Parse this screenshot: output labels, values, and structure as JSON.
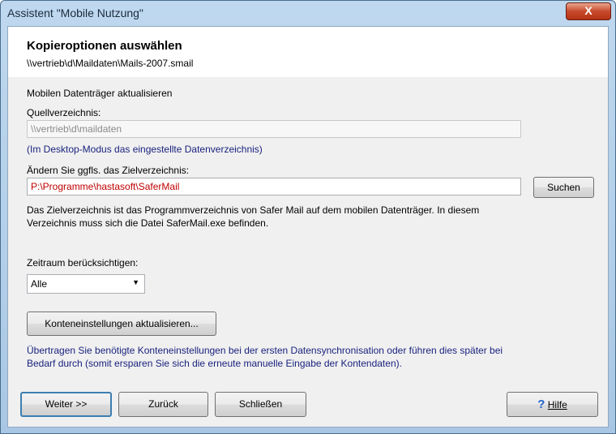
{
  "window": {
    "title": "Assistent \"Mobile Nutzung\"",
    "close_label": "X"
  },
  "header": {
    "title": "Kopieroptionen auswählen",
    "path": "\\\\vertrieb\\d\\Maildaten\\Mails-2007.smail"
  },
  "section": {
    "heading": "Mobilen Datenträger aktualisieren",
    "source_label": "Quellverzeichnis:",
    "source_value": "\\\\vertrieb\\d\\maildaten",
    "source_hint": "(Im Desktop-Modus das eingestellte Datenverzeichnis)",
    "target_label": "Ändern Sie ggfls. das Zielverzeichnis:",
    "target_value": "P:\\Programme\\hastasoft\\SaferMail",
    "search_button": "Suchen",
    "target_info": "Das Zielverzeichnis ist das Programmverzeichnis von Safer Mail auf dem mobilen Datenträger. In diesem Verzeichnis muss sich die Datei SaferMail.exe befinden."
  },
  "period": {
    "label": "Zeitraum berücksichtigen:",
    "selected": "Alle"
  },
  "accounts": {
    "button": "Konteneinstellungen aktualisieren...",
    "info": "Übertragen Sie benötigte Konteneinstellungen bei der ersten Datensynchronisation oder führen dies später bei Bedarf durch (somit ersparen Sie sich die erneute manuelle Eingabe der Kontendaten)."
  },
  "footer": {
    "next": "Weiter >>",
    "back": "Zurück",
    "close": "Schließen",
    "help": "Hilfe"
  },
  "colors": {
    "target_text": "#c00000",
    "hint_text": "#1a237e",
    "help_icon": "#1e62c9"
  }
}
